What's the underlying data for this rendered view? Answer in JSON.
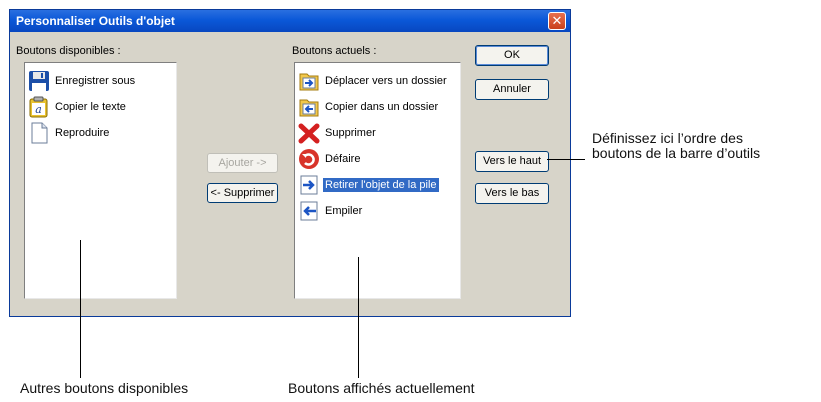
{
  "dialog": {
    "title": "Personnaliser Outils d'objet",
    "close_glyph": "✕"
  },
  "available": {
    "label": "Boutons disponibles :",
    "items": [
      {
        "label": "Enregistrer sous",
        "icon": "floppy-disk-icon"
      },
      {
        "label": "Copier le texte",
        "icon": "copy-text-icon"
      },
      {
        "label": "Reproduire",
        "icon": "document-icon"
      }
    ]
  },
  "current": {
    "label": "Boutons actuels :",
    "items": [
      {
        "label": "Déplacer vers un dossier",
        "icon": "move-to-folder-icon"
      },
      {
        "label": "Copier dans un dossier",
        "icon": "copy-to-folder-icon"
      },
      {
        "label": "Supprimer",
        "icon": "delete-x-icon"
      },
      {
        "label": "Défaire",
        "icon": "undo-icon"
      },
      {
        "label": "Retirer l'objet de la pile",
        "icon": "pop-stack-icon",
        "selected": true
      },
      {
        "label": "Empiler",
        "icon": "push-stack-icon"
      }
    ]
  },
  "buttons": {
    "add": "Ajouter ->",
    "remove": "<- Supprimer",
    "ok": "OK",
    "cancel": "Annuler",
    "move_up": "Vers le haut",
    "move_down": "Vers le bas"
  },
  "annotations": {
    "order_line1": "Définissez ici l’ordre des",
    "order_line2": "boutons de la barre d’outils",
    "available": "Autres boutons disponibles",
    "current": "Boutons affichés actuellement"
  },
  "colors": {
    "selection": "#316ac5",
    "titlebar": "#0b58d8",
    "dialog_bg": "#d7d4c9"
  }
}
